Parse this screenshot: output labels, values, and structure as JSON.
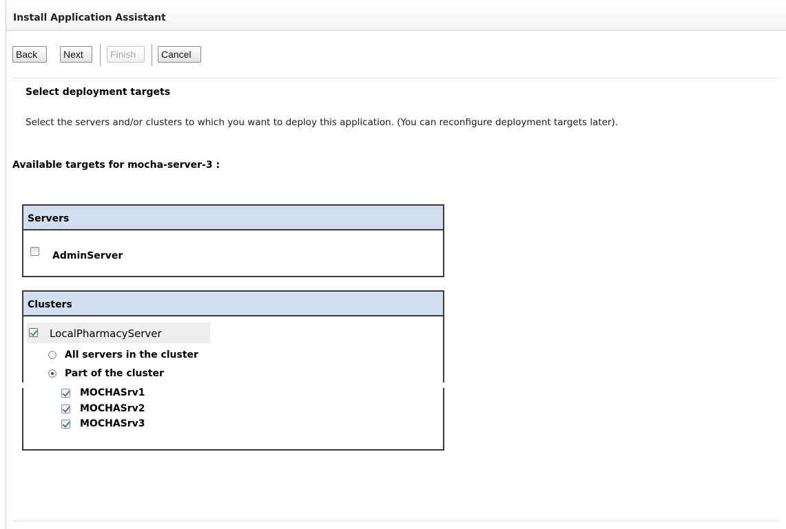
{
  "window": {
    "title": "Install Application Assistant"
  },
  "toolbar": {
    "back_label": "Back",
    "next_label": "Next",
    "finish_label": "Finish",
    "cancel_label": "Cancel"
  },
  "section": {
    "heading": "Select deployment targets",
    "description": "Select the servers and/or clusters to which you want to deploy this application. (You can reconfigure deployment targets later).",
    "available_label": "Available targets for mocha-server-3 :"
  },
  "servers": {
    "header": "Servers",
    "items": [
      {
        "label": "AdminServer",
        "checked": false
      }
    ]
  },
  "clusters": {
    "header": "Clusters",
    "cluster": {
      "label": "LocalPharmacyServer",
      "checked": true
    },
    "options": [
      {
        "label": "All servers in the cluster",
        "selected": false
      },
      {
        "label": "Part of the cluster",
        "selected": true
      }
    ],
    "members": [
      {
        "label": "MOCHASrv1",
        "checked": true
      },
      {
        "label": "MOCHASrv2",
        "checked": true
      },
      {
        "label": "MOCHASrv3",
        "checked": true
      }
    ]
  },
  "colors": {
    "panel_header_bg": "#d2dff1",
    "border": "#3a3a3a",
    "check_green": "#2e9a2e",
    "check_blue": "#4a6aa8"
  }
}
